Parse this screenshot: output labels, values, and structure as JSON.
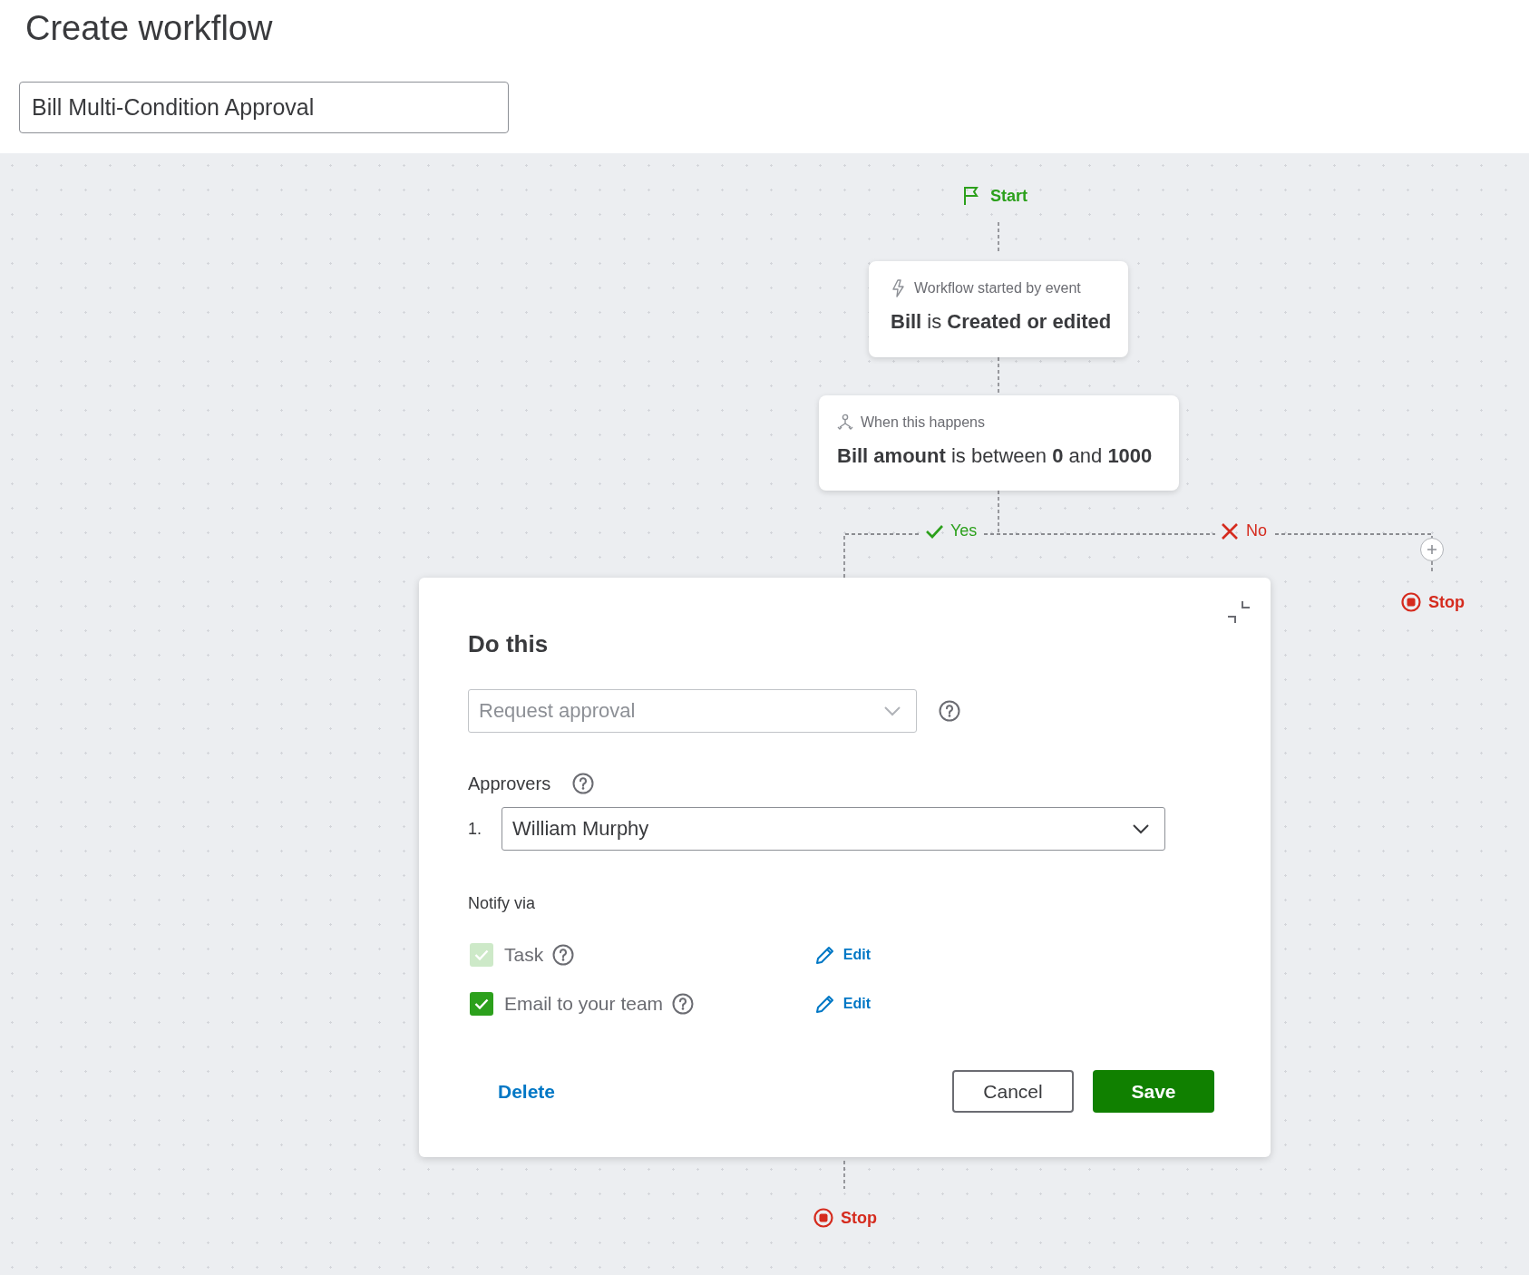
{
  "header": {
    "title": "Create workflow",
    "name_field": {
      "value": "Bill Multi-Condition Approval"
    }
  },
  "flow": {
    "start": {
      "label": "Start"
    },
    "trigger": {
      "caption": "Workflow started by event",
      "text": "**Bill** is **Created or edited**"
    },
    "condition": {
      "caption": "When this happens",
      "text": "**Bill amount** is between **0** and **1000**"
    },
    "branches": [
      {
        "kind": "yes",
        "label": "Yes"
      },
      {
        "kind": "no",
        "label": "No"
      }
    ],
    "stops": [
      {
        "label": "Stop"
      },
      {
        "label": "Stop"
      }
    ]
  },
  "action_panel": {
    "title": "Do this",
    "action_select": {
      "value": "Request approval",
      "disabled": true
    },
    "approvers_label": "Approvers",
    "approvers": [
      {
        "index": "1.",
        "value": "William Murphy"
      }
    ],
    "notify_label": "Notify via",
    "notify_options": [
      {
        "label": "Task",
        "checked": true,
        "disabled": true,
        "edit": "Edit"
      },
      {
        "label": "Email to your team",
        "checked": true,
        "disabled": false,
        "edit": "Edit"
      }
    ],
    "buttons": [
      {
        "kind": "link",
        "label": "Delete"
      },
      {
        "kind": "secondary",
        "label": "Cancel"
      },
      {
        "kind": "primary",
        "label": "Save"
      }
    ]
  }
}
